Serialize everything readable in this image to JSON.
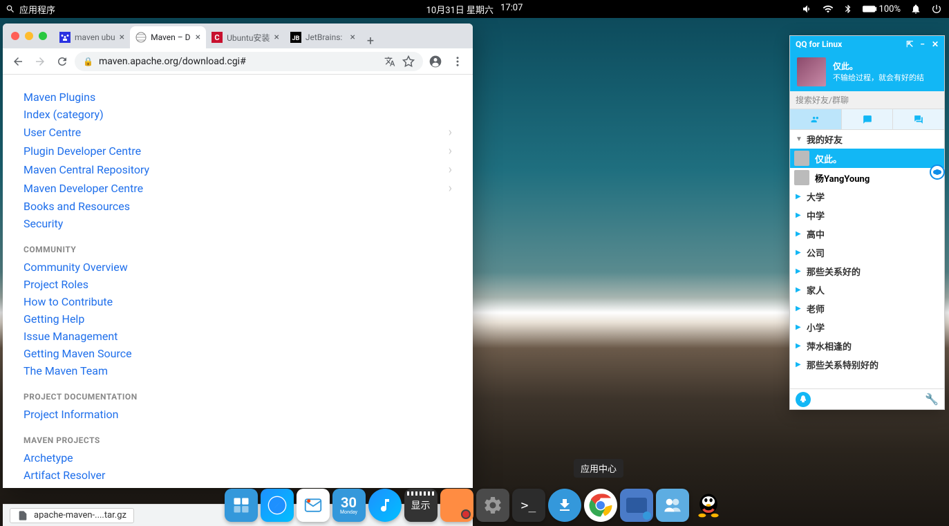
{
  "topbar": {
    "apps_label": "应用程序",
    "date": "10月31日 星期六",
    "time": "17:07",
    "battery": "100%"
  },
  "browser": {
    "tabs": [
      {
        "title": "maven ubu"
      },
      {
        "title": "Maven – D"
      },
      {
        "title": "Ubuntu安装"
      },
      {
        "title": "JetBrains:"
      }
    ],
    "url": "maven.apache.org/download.cgi#",
    "sidebar": {
      "section1": [
        "Maven Plugins",
        "Index (category)",
        "User Centre",
        "Plugin Developer Centre",
        "Maven Central Repository",
        "Maven Developer Centre",
        "Books and Resources",
        "Security"
      ],
      "section1_chev": [
        false,
        false,
        true,
        true,
        true,
        true,
        false,
        false
      ],
      "heading2": "COMMUNITY",
      "section2": [
        "Community Overview",
        "Project Roles",
        "How to Contribute",
        "Getting Help",
        "Issue Management",
        "Getting Maven Source",
        "The Maven Team"
      ],
      "heading3": "PROJECT DOCUMENTATION",
      "section3": [
        "Project Information"
      ],
      "heading4": "MAVEN PROJECTS",
      "section4": [
        "Archetype",
        "Artifact Resolver"
      ]
    }
  },
  "download": {
    "file": "apache-maven-....tar.gz"
  },
  "qq": {
    "title": "QQ for Linux",
    "name": "仅此。",
    "sig": "不输给过程，就会有好的结",
    "search_placeholder": "搜索好友/群聊",
    "group_open": "我的好友",
    "contacts": [
      {
        "name": "仅此。",
        "selected": true
      },
      {
        "name": "杨YangYoung",
        "selected": false
      }
    ],
    "groups": [
      "大学",
      "中学",
      "高中",
      "公司",
      "那些关系好的",
      "家人",
      "老师",
      "小学",
      "萍水相逢的",
      "那些关系特别好的"
    ]
  },
  "dock": {
    "tooltip": "应用中心"
  }
}
